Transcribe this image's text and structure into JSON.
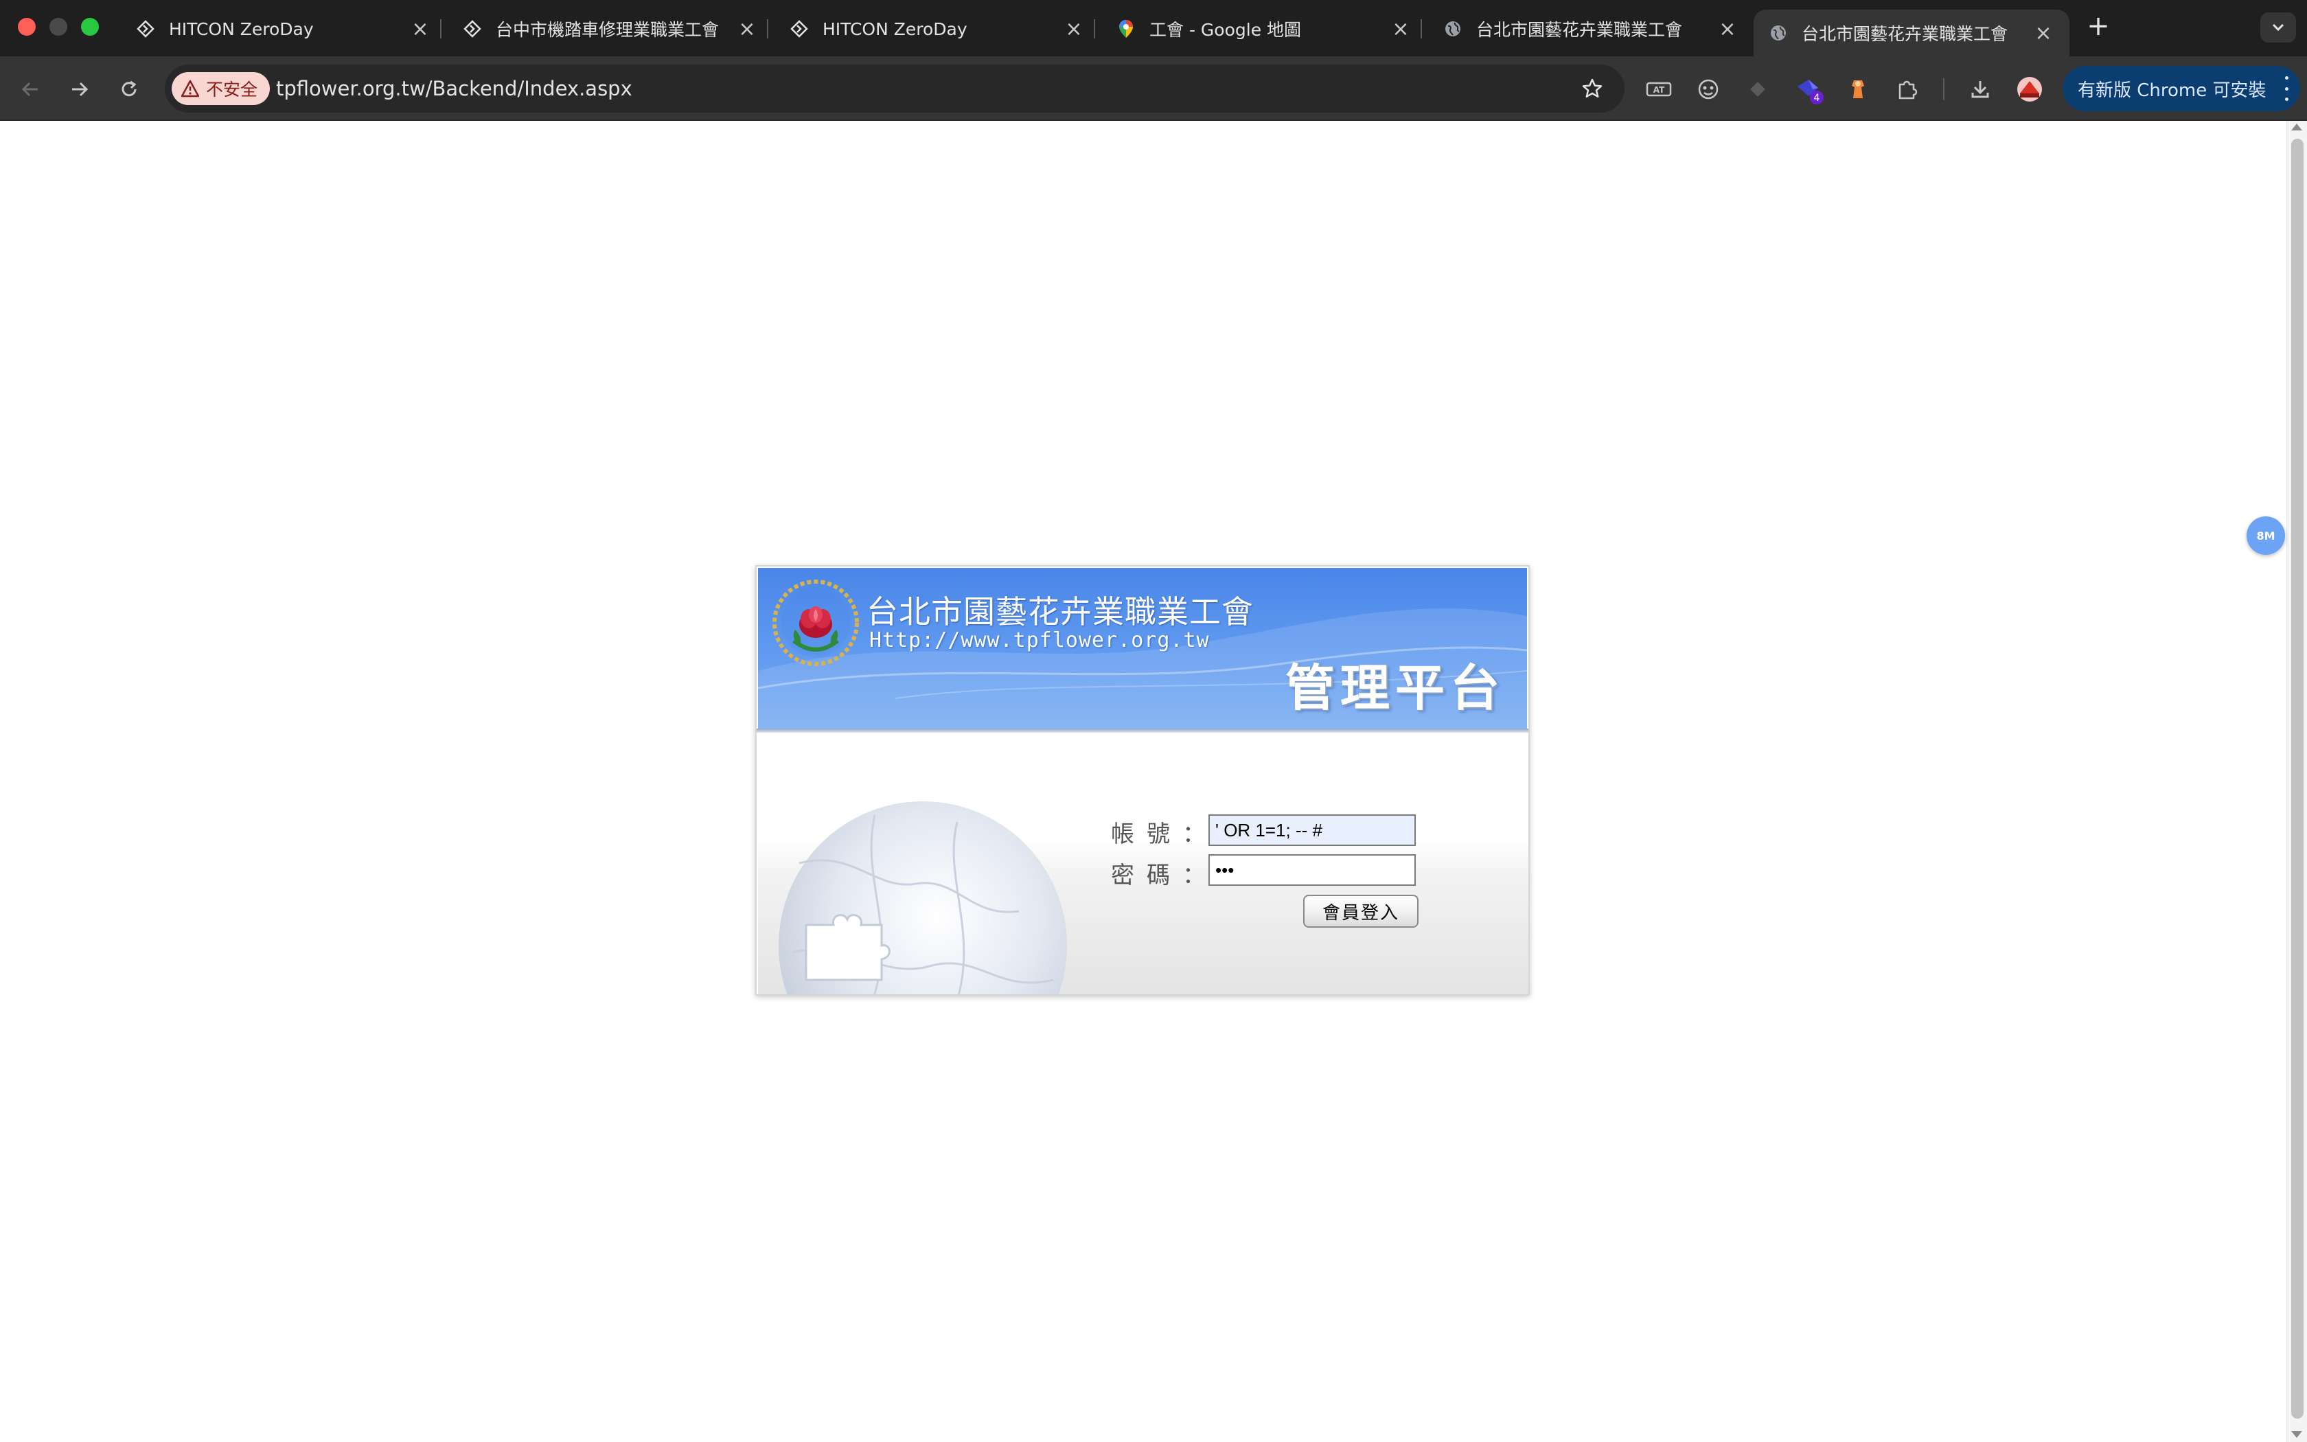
{
  "browser": {
    "tabs": [
      {
        "title": "HITCON ZeroDay",
        "favicon": "hitcon-icon",
        "active": false
      },
      {
        "title": "台中市機踏車修理業職業工會 ",
        "favicon": "hitcon-icon",
        "active": false
      },
      {
        "title": "HITCON ZeroDay",
        "favicon": "hitcon-icon",
        "active": false
      },
      {
        "title": "工會 - Google 地圖",
        "favicon": "google-maps-icon",
        "active": false
      },
      {
        "title": "台北市園藝花卉業職業工會",
        "favicon": "globe-icon",
        "active": false
      },
      {
        "title": "台北市園藝花卉業職業工會",
        "favicon": "globe-icon",
        "active": true
      }
    ],
    "security_label": "不安全",
    "url": "tpflower.org.tw/Backend/Index.aspx",
    "extension_badge": "4",
    "update_button_label": "有新版 Chrome 可安裝",
    "float_badge_label": "8M"
  },
  "page": {
    "org_name": "台北市園藝花卉業職業工會",
    "org_url": "Http://www.tpflower.org.tw",
    "platform_title": "管理平台",
    "form": {
      "account_label": "帳號：",
      "account_value": "' OR 1=1; -- #",
      "password_label": "密碼：",
      "password_value": "abc",
      "login_button": "會員登入"
    }
  },
  "colors": {
    "tabstrip_bg": "#1f1f1f",
    "toolbar_bg": "#353535",
    "security_chip_bg": "#f8d6d2",
    "update_button_bg": "#0b3d70",
    "banner_blue": "#4a86e8",
    "autofill_bg": "#e8f0fe"
  }
}
